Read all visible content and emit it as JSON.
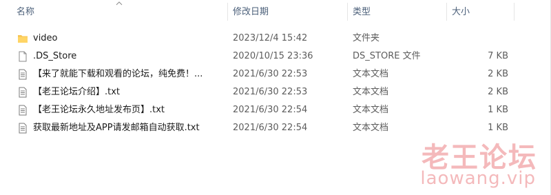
{
  "columns": {
    "name": "名称",
    "date": "修改日期",
    "type": "类型",
    "size": "大小"
  },
  "files": [
    {
      "icon": "folder-icon",
      "name": "video",
      "date": "2023/12/4 15:42",
      "type": "文件夹",
      "size": ""
    },
    {
      "icon": "blank-file-icon",
      "name": ".DS_Store",
      "date": "2020/10/15 23:36",
      "type": "DS_STORE 文件",
      "size": "7 KB"
    },
    {
      "icon": "text-file-icon",
      "name": "【来了就能下载和观看的论坛，纯免费！...",
      "date": "2021/6/30 22:53",
      "type": "文本文档",
      "size": "2 KB"
    },
    {
      "icon": "text-file-icon",
      "name": "【老王论坛介绍】.txt",
      "date": "2021/6/30 22:53",
      "type": "文本文档",
      "size": "2 KB"
    },
    {
      "icon": "text-file-icon",
      "name": "【老王论坛永久地址发布页】.txt",
      "date": "2021/6/30 22:54",
      "type": "文本文档",
      "size": "1 KB"
    },
    {
      "icon": "text-file-icon",
      "name": "获取最新地址及APP请发邮箱自动获取.txt",
      "date": "2021/6/30 22:54",
      "type": "文本文档",
      "size": "1 KB"
    }
  ],
  "watermark": {
    "title": "老王论坛",
    "url": "laowang.vip"
  },
  "colors": {
    "header_text": "#4c607a",
    "folder": "#f6c453",
    "watermark": "#f4b9bb"
  }
}
